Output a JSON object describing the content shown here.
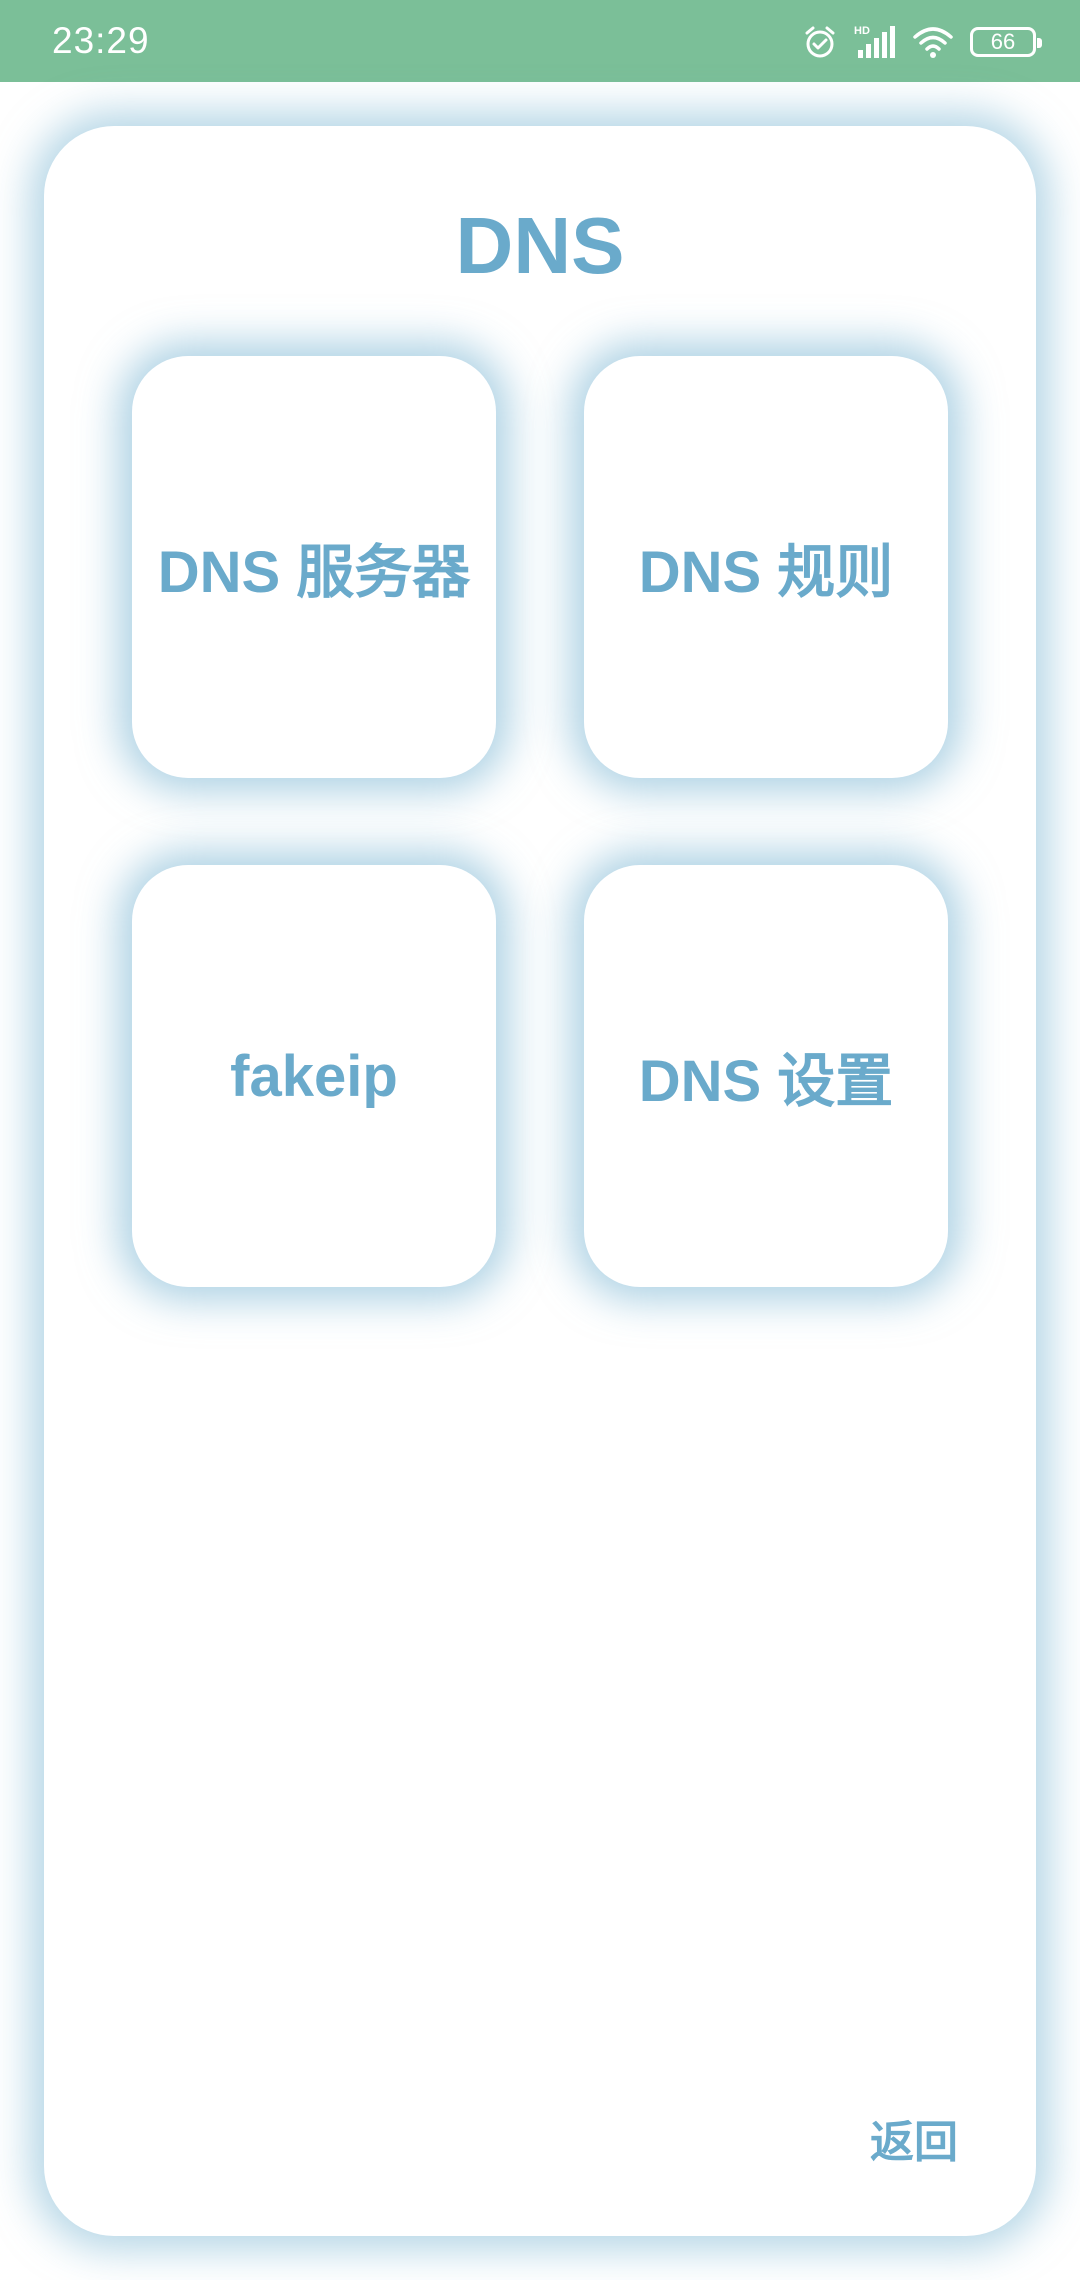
{
  "status_bar": {
    "time": "23:29",
    "battery_level": "66",
    "icons": [
      "alarm-icon",
      "hd-signal-icon",
      "wifi-icon",
      "battery-icon"
    ],
    "background_color": "#7bbf98"
  },
  "page": {
    "title": "DNS",
    "accent_color": "#6aaacb"
  },
  "menu": {
    "items": [
      {
        "label": "DNS 服务器"
      },
      {
        "label": "DNS 规则"
      },
      {
        "label": "fakeip"
      },
      {
        "label": "DNS 设置"
      }
    ]
  },
  "footer": {
    "back_label": "返回"
  }
}
